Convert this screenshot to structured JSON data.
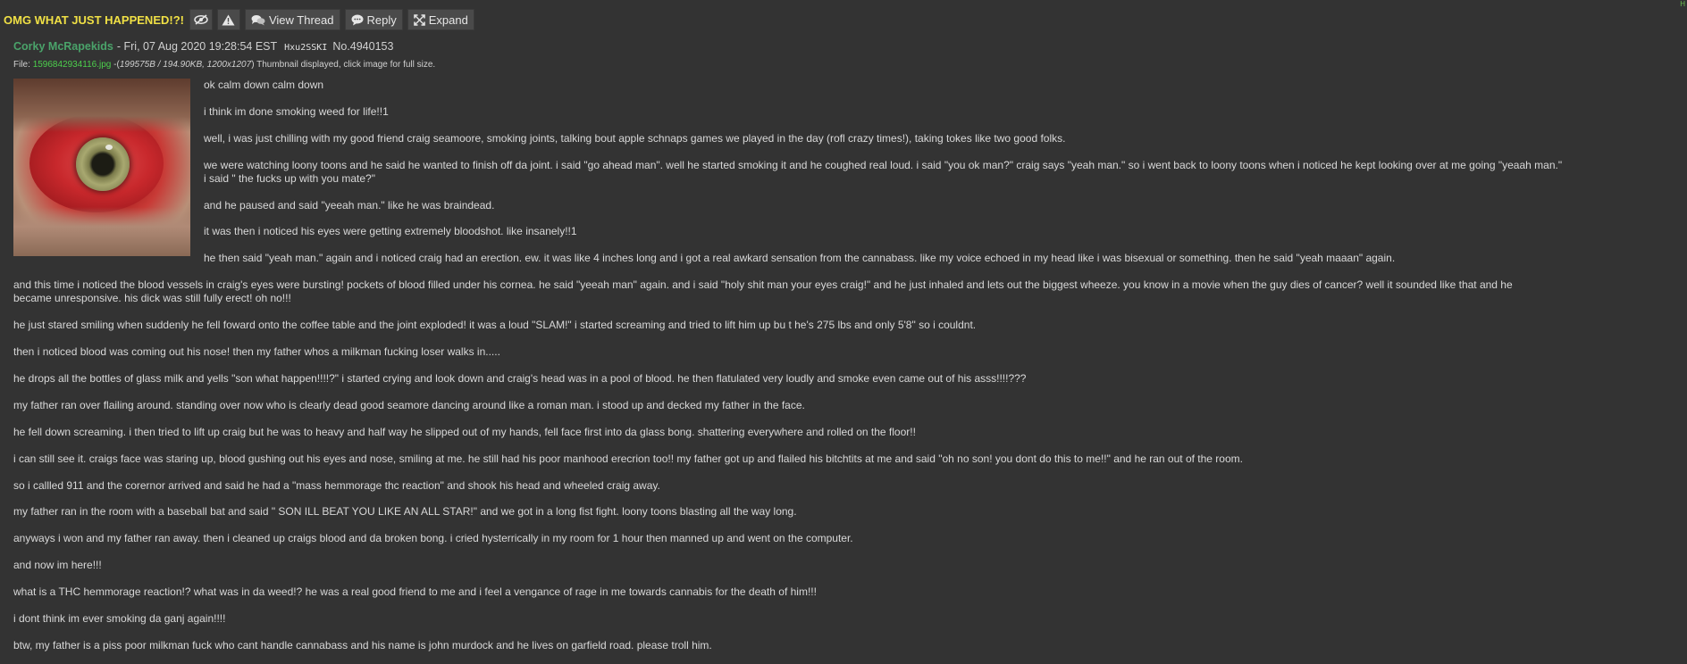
{
  "header": {
    "corner_mark": "H",
    "thread_title": "OMG WHAT JUST HAPPENED!?!",
    "buttons": {
      "hide_icon": "eye-slash-icon",
      "report_icon": "warning-icon",
      "view_thread_label": "View Thread",
      "view_thread_icon": "comments-icon",
      "reply_label": "Reply",
      "reply_icon": "comment-icon",
      "expand_label": "Expand",
      "expand_icon": "expand-arrows-icon"
    }
  },
  "post": {
    "name": "Corky McRapekids",
    "date": "- Fri, 07 Aug 2020 19:28:54 EST",
    "poster_id": "Hxu2SSKI",
    "number": "No.4940153",
    "file": {
      "prefix": "File:",
      "filename": "1596842934116.jpg",
      "dash": "-(",
      "meta": "199575B / 194.90KB, 1200x1207",
      "suffix": ") Thumbnail displayed, click image for full size."
    },
    "paragraphs": [
      "ok calm down calm down",
      "i think im done smoking weed for life!!1",
      "well, i was just chilling with my good friend craig seamoore, smoking joints, talking bout apple schnaps games we played in the day (rofl crazy times!), taking tokes like two good folks.",
      "we were watching loony toons and he said he wanted to finish off da joint. i said \"go ahead man\". well he started smoking it and he coughed real loud. i said \"you ok man?\" craig says \"yeah man.\" so i went back to loony toons when i noticed he kept looking over at me going \"yeaah man.\"",
      "i said \" the fucks up with you mate?\"",
      "and he paused and said \"yeeah man.\" like he was braindead.",
      "it was then i noticed his eyes were getting extremely bloodshot. like insanely!!1",
      "he then said \"yeah man.\" again and i noticed craig had an erection. ew. it was like 4 inches long and i got a real awkard sensation from the cannabass. like my voice echoed in my head like i was bisexual or something. then he said \"yeah maaan\" again.",
      "and this time i noticed the blood vessels in craig's eyes were bursting! pockets of blood filled under his cornea. he said \"yeeah man\" again. and i said \"holy shit man your eyes craig!\" and he just inhaled and lets out the biggest wheeze. you know in a movie when the guy dies of cancer? well it sounded like that and he",
      "became unresponsive. his dick was still fully erect! oh no!!!",
      "he just stared smiling when suddenly he fell foward onto the coffee table and the joint exploded! it was a loud \"SLAM!\" i started screaming and tried to lift him up bu t he's 275 lbs and only 5'8\" so i couldnt.",
      "then i noticed blood was coming out his nose! then my father whos a milkman fucking loser walks in.....",
      "he drops all the bottles of glass milk and yells \"son what happen!!!!?\" i started crying and look down and craig's head was in a pool of blood. he then flatulated very loudly and smoke even came out of his asss!!!!???",
      "my father ran over flailing around. standing over now who is clearly dead good seamore dancing around like a roman man. i stood up and decked my father in the face.",
      "he fell down screaming. i then tried to lift up craig but he was to heavy and half way he slipped out of my hands, fell face first into da glass bong. shattering everywhere and rolled on the floor!!",
      "i can still see it. craigs face was staring up, blood gushing out his eyes and nose, smiling at me. he still had his poor manhood erecrion too!! my father got up and flailed his bitchtits at me and said \"oh no son! you dont do this to me!!\" and he ran out of the room.",
      "so i callled 911 and the corernor arrived and said he had a \"mass hemmorage thc reaction\" and shook his head and wheeled craig away.",
      "my father ran in the room with a baseball bat and said \" SON ILL BEAT YOU LIKE AN ALL STAR!\" and we got in a long fist fight. loony toons blasting all the way long.",
      "anyways i won and my father ran away. then i cleaned up craigs blood and da broken bong. i cried hysterrically in my room for 1 hour then manned up and went on the computer.",
      "and now im here!!!",
      "what is a THC hemmorage reaction!? what was in da weed!? he was a real good friend to me and i feel a vengance of rage in me towards cannabis for the death of him!!!",
      "i dont think im ever smoking da ganj again!!!!",
      "btw, my father is a piss poor milkman fuck who cant handle cannabass and his name is john murdock and he lives on garfield road. please troll him."
    ],
    "thumbnail_icon": "bloodshot-eye-photo"
  }
}
